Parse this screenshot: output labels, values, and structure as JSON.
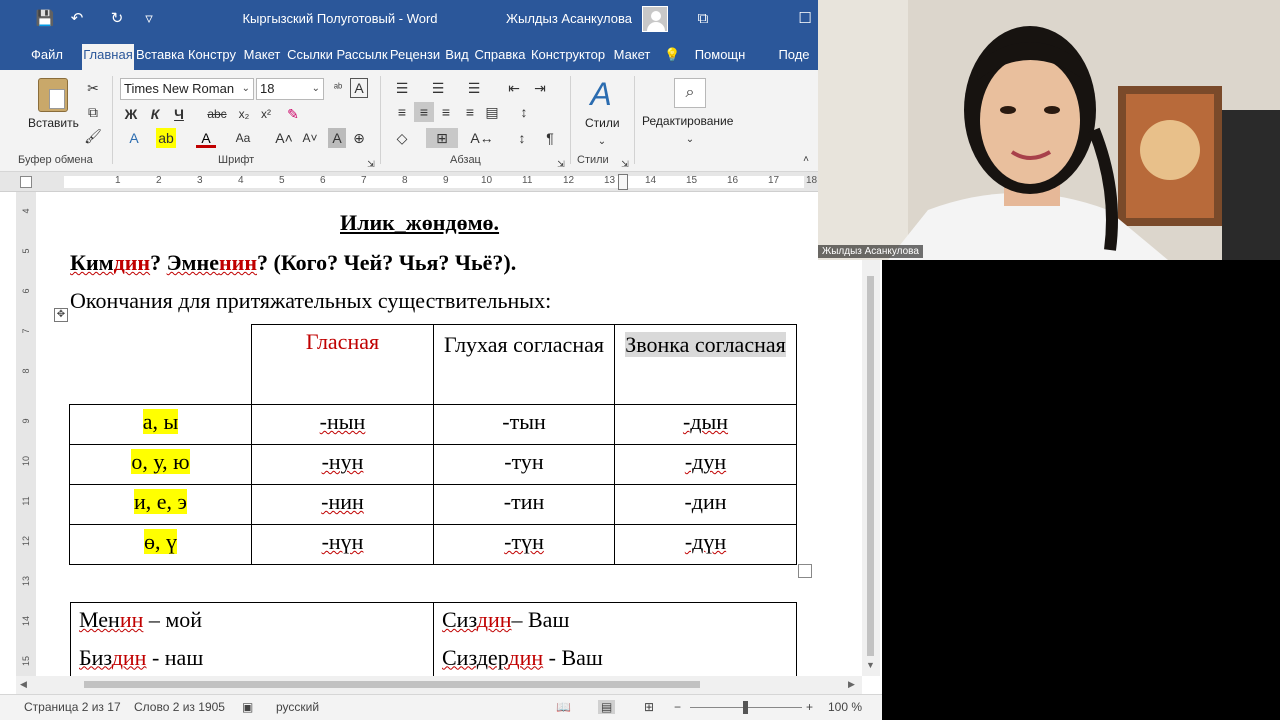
{
  "titlebar": {
    "title": "Кыргызский Полуготовый  -  Word",
    "user": "Жылдыз Асанкулова",
    "qat": {
      "save": "💾",
      "undo": "↶",
      "redo": "↻",
      "more": "▿"
    },
    "win": {
      "restore": "⧉",
      "maximize": "☐"
    }
  },
  "tabs": [
    "Файл",
    "Главная",
    "Вставка",
    "Констру",
    "Макет",
    "Ссылки",
    "Рассылк",
    "Рецензи",
    "Вид",
    "Справка",
    "Конструктор",
    "Макет",
    "Помощн",
    "Поде"
  ],
  "ribbon": {
    "paste": "Вставить",
    "clipboard": "Буфер обмена",
    "font_name": "Times New Roman",
    "font_size": "18",
    "font_group": "Шрифт",
    "paragraph_group": "Абзац",
    "styles": "Стили",
    "styles_group": "Стили",
    "editing": "Редактирование",
    "font_buttons": {
      "bold": "Ж",
      "italic": "К",
      "underline": "Ч",
      "strike": "abc",
      "sub": "x₂",
      "super": "x²",
      "case": "Aa",
      "grow": "A˄",
      "shrink": "A˅",
      "clear": "A"
    }
  },
  "ruler": {
    "h_ticks": [
      "1",
      "2",
      "3",
      "4",
      "5",
      "6",
      "7",
      "8",
      "9",
      "10",
      "11",
      "12",
      "13",
      "14",
      "15",
      "16",
      "17",
      "18"
    ],
    "v_ticks": [
      "4",
      "5",
      "6",
      "7",
      "8",
      "9",
      "10",
      "11",
      "12",
      "13",
      "14",
      "15"
    ]
  },
  "document": {
    "heading": "Илик_жөндөмө.",
    "question": {
      "w1a": "Ким",
      "w1b": "дин",
      "sep1": "? ",
      "w2a": "Эмне",
      "w2b": "нин",
      "rest": "? (Кого? Чей? Чья? Чьё?)."
    },
    "intro": "Окончания для притяжательных существительных:",
    "vowel_table": {
      "headers": [
        "",
        "Гласная",
        "Глухая согласная",
        "Звонка согласная"
      ],
      "rows": [
        [
          "а, ы",
          "-нын",
          "-тын",
          "-дын"
        ],
        [
          "о, у, ю",
          "-нун",
          "-тун",
          "-дун"
        ],
        [
          "и, е, э",
          "-нин",
          "-тин",
          "-дин"
        ],
        [
          "ө, ү",
          "-нүн",
          "-түн",
          "-дүн"
        ]
      ]
    },
    "pronoun_table": {
      "rows": [
        {
          "left_a": "Мен",
          "left_b": "ин",
          "left_c": " – мой",
          "right_a": "Сиз",
          "right_b": "дин",
          "right_c": "– Ваш"
        },
        {
          "left_a": "Биз",
          "left_b": "дин",
          "left_c": " - наш",
          "right_a": "Сиздер",
          "right_b": "дин",
          "right_c": " - Ваш"
        }
      ]
    }
  },
  "statusbar": {
    "page": "Страница 2 из 17",
    "words": "Слово 2 из 1905",
    "language": "русский",
    "zoom": "100 %"
  },
  "webcam": {
    "name": "Жылдыз Асанкулова"
  }
}
